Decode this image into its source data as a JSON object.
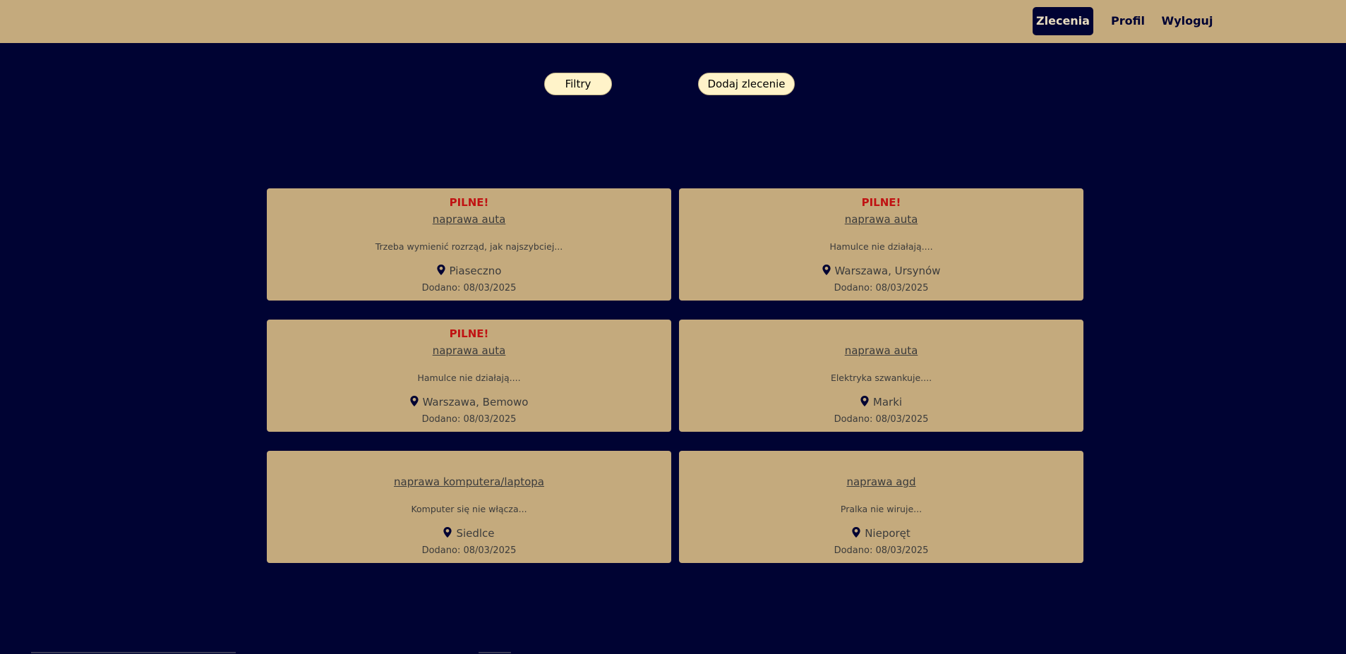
{
  "nav": {
    "items": [
      {
        "label": "Zlecenia",
        "active": true
      },
      {
        "label": "Profil",
        "active": false
      },
      {
        "label": "Wyloguj",
        "active": false
      }
    ]
  },
  "toolbar": {
    "filters_label": "Filtry",
    "add_label": "Dodaj zlecenie"
  },
  "cards": [
    {
      "urgent": "PILNE!",
      "title": "naprawa auta",
      "desc": "Trzeba wymienić rozrząd, jak najszybciej...",
      "location": "Piaseczno",
      "date": "Dodano: 08/03/2025"
    },
    {
      "urgent": "PILNE!",
      "title": "naprawa auta",
      "desc": "Hamulce nie działają....",
      "location": "Warszawa, Ursynów",
      "date": "Dodano: 08/03/2025"
    },
    {
      "urgent": "PILNE!",
      "title": "naprawa auta",
      "desc": "Hamulce nie działają....",
      "location": "Warszawa, Bemowo",
      "date": "Dodano: 08/03/2025"
    },
    {
      "urgent": "",
      "title": "naprawa auta",
      "desc": "Elektryka szwankuje....",
      "location": "Marki",
      "date": "Dodano: 08/03/2025"
    },
    {
      "urgent": "",
      "title": "naprawa komputera/laptopa",
      "desc": "Komputer się nie włącza...",
      "location": "Siedlce",
      "date": "Dodano: 08/03/2025"
    },
    {
      "urgent": "",
      "title": "naprawa agd",
      "desc": "Pralka nie wiruje...",
      "location": "Nieporęt",
      "date": "Dodano: 08/03/2025"
    }
  ],
  "colors": {
    "background": "#000333",
    "accent": "#c4aa7d",
    "urgent": "#c01313",
    "button": "#fff3c9"
  }
}
